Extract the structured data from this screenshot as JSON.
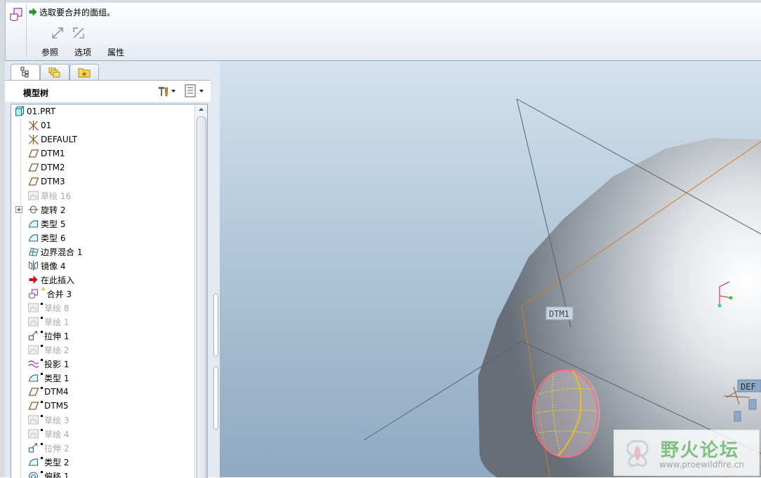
{
  "dashboard": {
    "prompt": "选取要合并的面组。",
    "tabs": {
      "references": "参照",
      "options": "选项",
      "properties": "属性"
    }
  },
  "navigator": {
    "title": "模型树",
    "tabs": [
      "model-tree-tab",
      "folder-browser-tab",
      "favorites-tab"
    ]
  },
  "model_tree": {
    "root": "01.PRT",
    "items": [
      {
        "label": "01",
        "icon": "csys-icon",
        "state": "normal"
      },
      {
        "label": "DEFAULT",
        "icon": "csys-icon",
        "state": "normal"
      },
      {
        "label": "DTM1",
        "icon": "datum-plane-icon",
        "state": "normal"
      },
      {
        "label": "DTM2",
        "icon": "datum-plane-icon",
        "state": "normal"
      },
      {
        "label": "DTM3",
        "icon": "datum-plane-icon",
        "state": "normal"
      },
      {
        "label": "草绘 16",
        "icon": "sketch-icon",
        "state": "dim"
      },
      {
        "label": "旋转 2",
        "icon": "revolve-icon",
        "state": "normal"
      },
      {
        "label": "类型 5",
        "icon": "surface-icon",
        "state": "normal"
      },
      {
        "label": "类型 6",
        "icon": "surface-icon",
        "state": "normal"
      },
      {
        "label": "边界混合 1",
        "icon": "boundary-blend-icon",
        "state": "normal"
      },
      {
        "label": "镜像 4",
        "icon": "mirror-icon",
        "state": "normal"
      },
      {
        "label": "在此插入",
        "icon": "insert-here-arrow-icon",
        "state": "normal"
      },
      {
        "label": "合并 3",
        "icon": "merge-icon",
        "state": "normal"
      },
      {
        "label": "草绘 8",
        "icon": "sketch-icon",
        "state": "dim"
      },
      {
        "label": "草绘 1",
        "icon": "sketch-icon",
        "state": "dim"
      },
      {
        "label": "拉伸 1",
        "icon": "extrude-icon",
        "state": "normal"
      },
      {
        "label": "草绘 2",
        "icon": "sketch-icon",
        "state": "dim"
      },
      {
        "label": "投影 1",
        "icon": "projection-icon",
        "state": "normal"
      },
      {
        "label": "类型 1",
        "icon": "surface-icon",
        "state": "normal"
      },
      {
        "label": "DTM4",
        "icon": "datum-plane-icon",
        "state": "normal"
      },
      {
        "label": "DTM5",
        "icon": "datum-plane-icon",
        "state": "normal"
      },
      {
        "label": "草绘 3",
        "icon": "sketch-icon",
        "state": "dim"
      },
      {
        "label": "草绘 4",
        "icon": "sketch-icon",
        "state": "dim"
      },
      {
        "label": "拉伸 2",
        "icon": "extrude-icon",
        "state": "dim"
      },
      {
        "label": "类型 2",
        "icon": "surface-icon",
        "state": "normal"
      },
      {
        "label": "偏移 1",
        "icon": "offset-icon",
        "state": "normal"
      }
    ]
  },
  "viewport": {
    "labels": {
      "dtm1": "DTM1",
      "default": "DEF"
    }
  },
  "watermark": {
    "title": "野火论坛",
    "url": "www.proewildfire.cn"
  },
  "colors": {
    "accent_green": "#1e9e2e",
    "insert_arrow": "#d01010",
    "suppressed_text": "#a9a9a9"
  }
}
